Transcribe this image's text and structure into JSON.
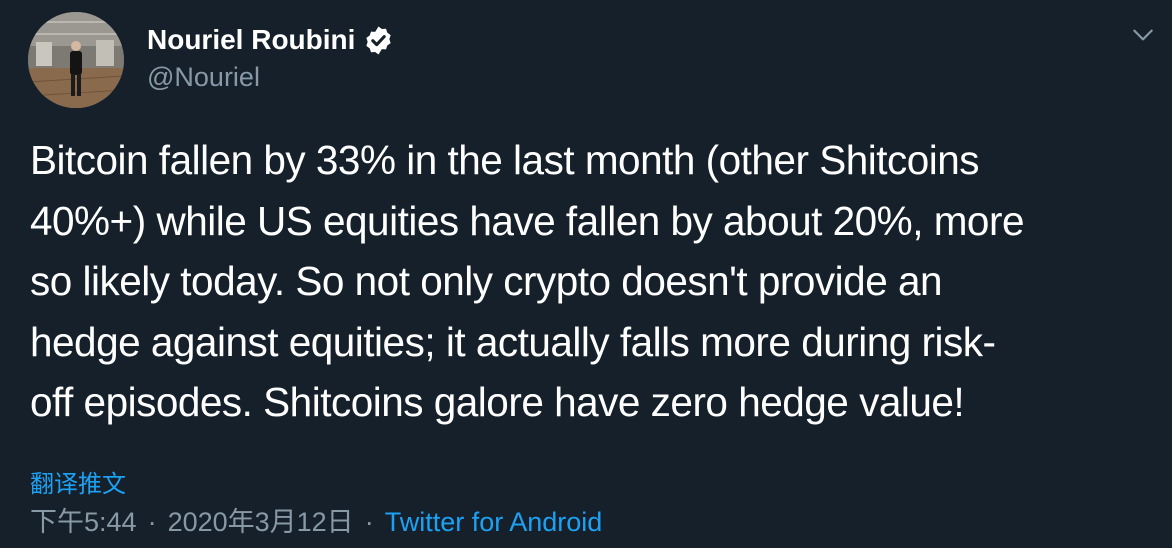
{
  "author": {
    "name": "Nouriel Roubini",
    "handle": "@Nouriel",
    "verified": true,
    "avatar_icon": "profile-photo"
  },
  "tweet": {
    "text": "Bitcoin fallen by 33% in the last month (other Shitcoins\n40%+) while US equities have fallen by about 20%, more\nso likely today. So not only crypto doesn't provide an\nhedge against equities; it actually falls more during risk-\noff episodes. Shitcoins galore have zero hedge value!",
    "translate_label": "翻译推文",
    "time": "下午5:44",
    "date": "2020年3月12日",
    "separator": "·",
    "source": "Twitter for Android"
  },
  "icons": {
    "verified": "verified-badge-icon",
    "menu": "chevron-down-icon"
  },
  "colors": {
    "background": "#15202b",
    "text": "#ffffff",
    "secondary": "#8899a6",
    "accent": "#1da1f2"
  }
}
